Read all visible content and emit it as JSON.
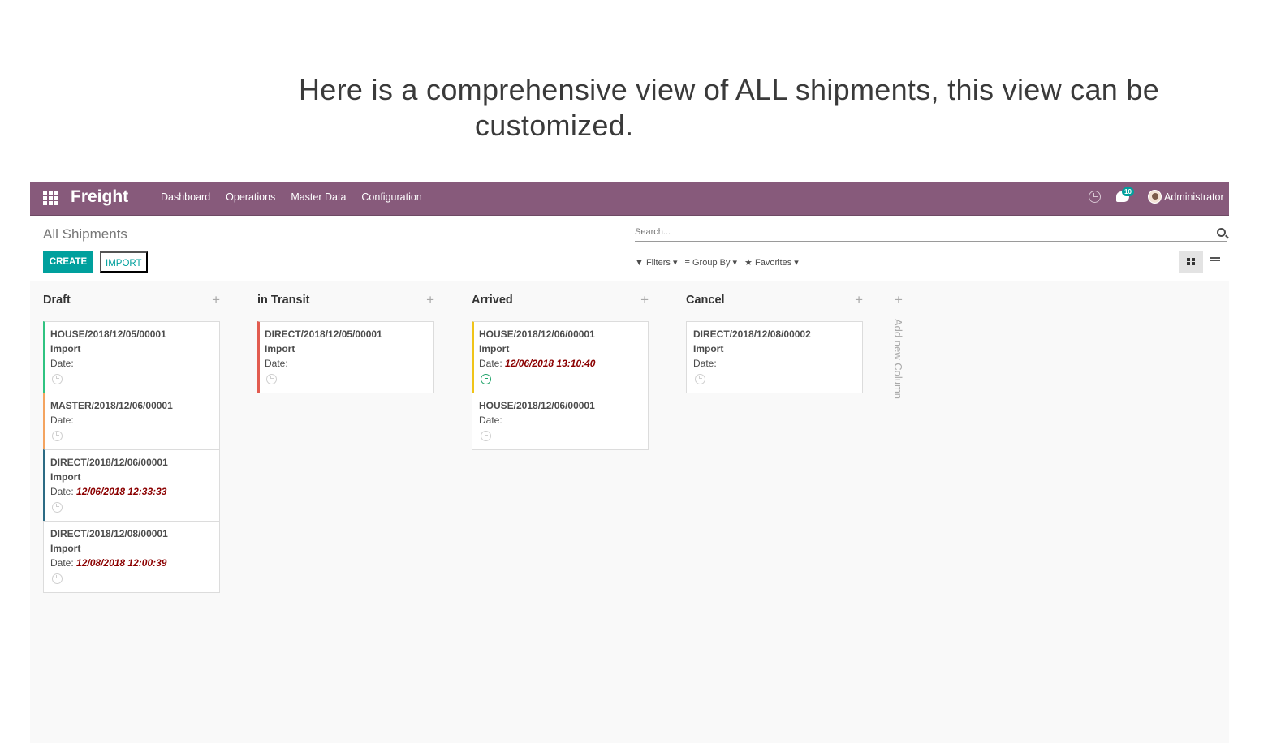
{
  "caption": {
    "line1": "Here is a comprehensive view of ALL shipments, this view can be",
    "line2": "customized."
  },
  "navbar": {
    "brand": "Freight",
    "menu": [
      "Dashboard",
      "Operations",
      "Master Data",
      "Configuration"
    ],
    "chat_badge": "10",
    "user": "Administrator",
    "accent_color": "#875a7b"
  },
  "control_panel": {
    "breadcrumb": "All Shipments",
    "create_label": "CREATE",
    "import_label": "IMPORT",
    "search_placeholder": "Search...",
    "filters_label": "Filters",
    "groupby_label": "Group By",
    "favorites_label": "Favorites",
    "primary_color": "#00a09d"
  },
  "kanban": {
    "add_column_label": "Add new Column",
    "columns": [
      {
        "title": "Draft",
        "cards": [
          {
            "ref": "HOUSE/2018/12/05/00001",
            "type": "Import",
            "date_label": "Date:",
            "date_value": "",
            "color": "#30c381",
            "clock": "grey"
          },
          {
            "ref": "MASTER/2018/12/06/00001",
            "type": "",
            "date_label": "Date:",
            "date_value": "",
            "color": "#f4a460",
            "clock": "grey"
          },
          {
            "ref": "DIRECT/2018/12/06/00001",
            "type": "Import",
            "date_label": "Date:",
            "date_value": "12/06/2018 12:33:33",
            "color": "#2c6b84",
            "clock": "grey"
          },
          {
            "ref": "DIRECT/2018/12/08/00001",
            "type": "Import",
            "date_label": "Date:",
            "date_value": "12/08/2018 12:00:39",
            "color": "#dcdcdc",
            "clock": "grey"
          }
        ]
      },
      {
        "title": "in Transit",
        "cards": [
          {
            "ref": "DIRECT/2018/12/05/00001",
            "type": "Import",
            "date_label": "Date:",
            "date_value": "",
            "color": "#e25c50",
            "clock": "grey"
          }
        ]
      },
      {
        "title": "Arrived",
        "cards": [
          {
            "ref": "HOUSE/2018/12/06/00001",
            "type": "Import",
            "date_label": "Date:",
            "date_value": "12/06/2018 13:10:40",
            "color": "#f0c419",
            "clock": "green"
          },
          {
            "ref": "HOUSE/2018/12/06/00001",
            "type": "",
            "date_label": "Date:",
            "date_value": "",
            "color": "#dcdcdc",
            "clock": "grey"
          }
        ]
      },
      {
        "title": "Cancel",
        "cards": [
          {
            "ref": "DIRECT/2018/12/08/00002",
            "type": "Import",
            "date_label": "Date:",
            "date_value": "",
            "color": "#dcdcdc",
            "clock": "grey"
          }
        ]
      }
    ]
  }
}
